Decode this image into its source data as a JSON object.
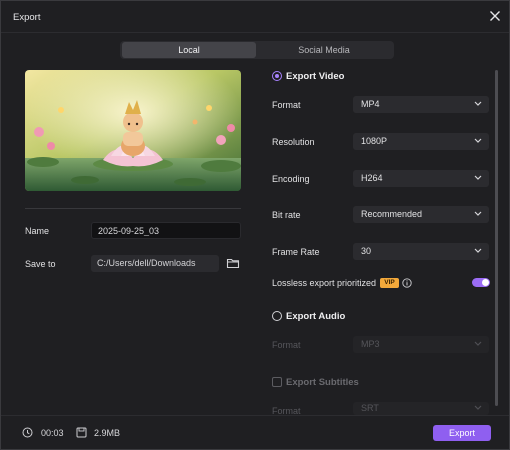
{
  "window": {
    "title": "Export"
  },
  "tabs": {
    "local": "Local",
    "social": "Social Media"
  },
  "left": {
    "name_label": "Name",
    "name_value": "2025-09-25_03",
    "save_label": "Save to",
    "save_path": "C:/Users/dell/Downloads"
  },
  "video": {
    "section": "Export Video",
    "format_label": "Format",
    "format_value": "MP4",
    "resolution_label": "Resolution",
    "resolution_value": "1080P",
    "encoding_label": "Encoding",
    "encoding_value": "H264",
    "bitrate_label": "Bit rate",
    "bitrate_value": "Recommended",
    "framerate_label": "Frame Rate",
    "framerate_value": "30",
    "lossless_label": "Lossless export prioritized",
    "vip_badge": "VIP",
    "lossless_enabled": true
  },
  "audio": {
    "section": "Export Audio",
    "format_label": "Format",
    "format_value": "MP3"
  },
  "subtitles": {
    "section": "Export Subtitles",
    "format_label": "Format",
    "format_value": "SRT"
  },
  "footer": {
    "duration": "00:03",
    "size": "2.9MB",
    "export_label": "Export"
  },
  "colors": {
    "accent": "#8f5ff0",
    "vip": "#f3a93b",
    "background": "#1f1f22"
  }
}
